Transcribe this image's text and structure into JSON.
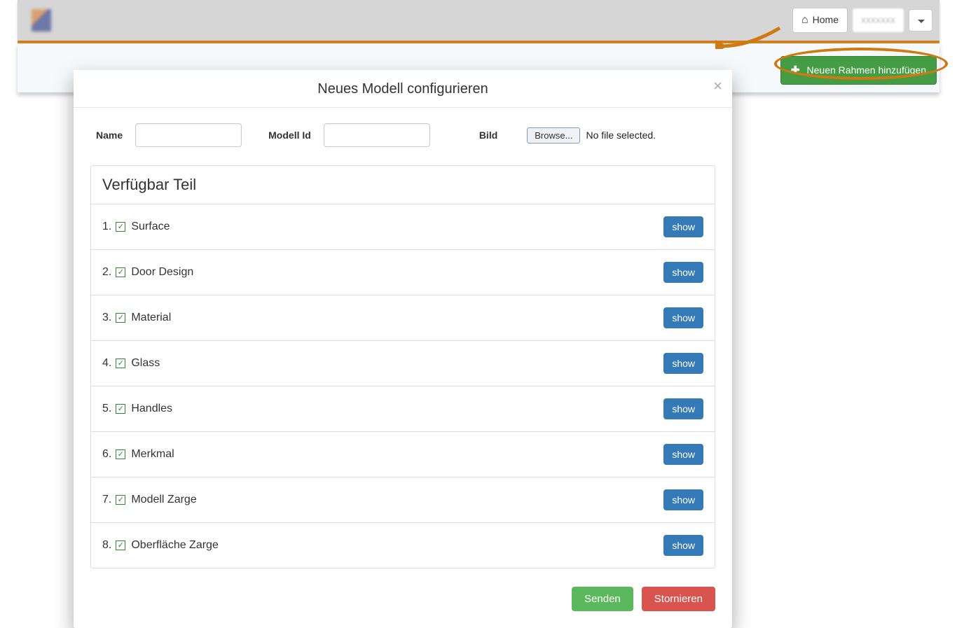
{
  "topbar": {
    "home_label": "Home",
    "user_label": "xxxxxxx"
  },
  "subbar": {
    "add_frame_label": "Neuen Rahmen hinzufügen"
  },
  "modal": {
    "title": "Neues Modell configurieren",
    "close": "×",
    "name_label": "Name",
    "name_value": "",
    "model_id_label": "Modell Id",
    "model_id_value": "",
    "image_label": "Bild",
    "browse_label": "Browse...",
    "file_status": "No file selected.",
    "panel_title": "Verfügbar Teil",
    "show_label": "show",
    "items": [
      {
        "n": "1.",
        "label": "Surface",
        "checked": true
      },
      {
        "n": "2.",
        "label": "Door Design",
        "checked": true
      },
      {
        "n": "3.",
        "label": "Material",
        "checked": true
      },
      {
        "n": "4.",
        "label": "Glass",
        "checked": true
      },
      {
        "n": "5.",
        "label": "Handles",
        "checked": true
      },
      {
        "n": "6.",
        "label": "Merkmal",
        "checked": true
      },
      {
        "n": "7.",
        "label": "Modell Zarge",
        "checked": true
      },
      {
        "n": "8.",
        "label": "Oberfläche Zarge",
        "checked": true
      }
    ],
    "send_label": "Senden",
    "cancel_label": "Stornieren"
  },
  "colors": {
    "accent_orange": "#e58a1f",
    "primary_blue": "#337ab7",
    "success_green": "#449d44",
    "danger_red": "#d9534f"
  }
}
